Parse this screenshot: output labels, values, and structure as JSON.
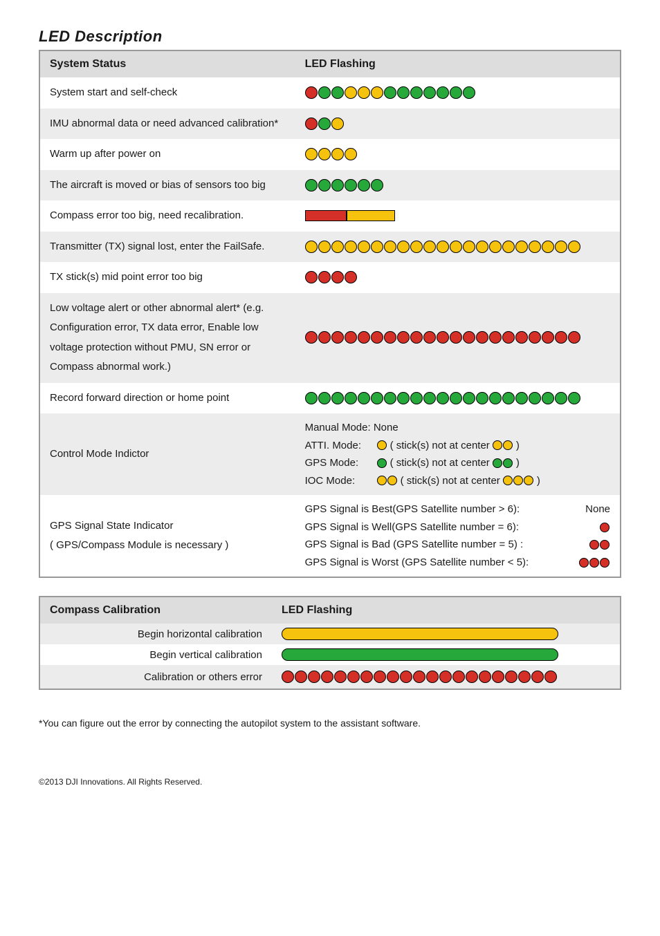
{
  "title": "LED Description",
  "colors": {
    "red": "#d43027",
    "green": "#26a83b",
    "yellow": "#f5c20e"
  },
  "table1": {
    "headers": {
      "col1": "System Status",
      "col2": "LED Flashing"
    },
    "rows": [
      {
        "label": "System start and self-check",
        "leds": [
          "red",
          "green",
          "green",
          "yellow",
          "yellow",
          "yellow",
          "green",
          "green",
          "green",
          "green",
          "green",
          "green",
          "green"
        ]
      },
      {
        "label": "IMU abnormal data or need advanced calibration*",
        "leds": [
          "red",
          "green",
          "yellow"
        ]
      },
      {
        "label": "Warm up after power on",
        "leds": [
          "yellow",
          "yellow",
          "yellow",
          "yellow"
        ]
      },
      {
        "label": "The aircraft is moved or bias of sensors too big",
        "leds": [
          "green",
          "green",
          "green",
          "green",
          "green",
          "green"
        ]
      },
      {
        "label": "Compass error too big, need recalibration.",
        "bars": [
          "red",
          "yellow"
        ]
      },
      {
        "label": "Transmitter (TX) signal lost, enter the FailSafe.",
        "leds": [
          "yellow",
          "yellow",
          "yellow",
          "yellow",
          "yellow",
          "yellow",
          "yellow",
          "yellow",
          "yellow",
          "yellow",
          "yellow",
          "yellow",
          "yellow",
          "yellow",
          "yellow",
          "yellow",
          "yellow",
          "yellow",
          "yellow",
          "yellow",
          "yellow"
        ]
      },
      {
        "label": "TX stick(s) mid point error too big",
        "leds": [
          "red",
          "red",
          "red",
          "red"
        ]
      },
      {
        "label": "Low voltage alert or other abnormal alert* (e.g. Configuration error, TX data error, Enable low voltage protection without PMU, SN error or Compass abnormal work.)",
        "leds": [
          "red",
          "red",
          "red",
          "red",
          "red",
          "red",
          "red",
          "red",
          "red",
          "red",
          "red",
          "red",
          "red",
          "red",
          "red",
          "red",
          "red",
          "red",
          "red",
          "red",
          "red"
        ]
      },
      {
        "label": "Record forward direction or home point",
        "leds": [
          "green",
          "green",
          "green",
          "green",
          "green",
          "green",
          "green",
          "green",
          "green",
          "green",
          "green",
          "green",
          "green",
          "green",
          "green",
          "green",
          "green",
          "green",
          "green",
          "green",
          "green"
        ]
      }
    ],
    "control_mode": {
      "label": "Control Mode Indictor",
      "lines": {
        "manual": "Manual Mode: None",
        "atti_label": "ATTI. Mode:",
        "gps_label": "GPS Mode:",
        "ioc_label": "IOC Mode:",
        "not_center": "( stick(s) not at center",
        "close_paren": ")"
      },
      "atti": {
        "base": [
          "yellow"
        ],
        "nc": [
          "yellow",
          "yellow"
        ]
      },
      "gps": {
        "base": [
          "green"
        ],
        "nc": [
          "green",
          "green"
        ]
      },
      "ioc": {
        "base": [
          "yellow",
          "yellow"
        ],
        "nc": [
          "yellow",
          "yellow",
          "yellow"
        ]
      }
    },
    "gps_signal": {
      "label": "GPS Signal State Indicator",
      "sublabel": "( GPS/Compass Module is necessary )",
      "lines": [
        {
          "text": "GPS Signal is Best(GPS Satellite number > 6):",
          "none": "None",
          "leds": []
        },
        {
          "text": "GPS Signal is Well(GPS Satellite number = 6):",
          "leds": [
            "red"
          ]
        },
        {
          "text": "GPS Signal is Bad (GPS Satellite number = 5) :",
          "leds": [
            "red",
            "red"
          ]
        },
        {
          "text": "GPS Signal is Worst (GPS Satellite number < 5):",
          "leds": [
            "red",
            "red",
            "red"
          ]
        }
      ]
    }
  },
  "table2": {
    "headers": {
      "col1": "Compass Calibration",
      "col2": "LED Flashing"
    },
    "rows": [
      {
        "label": "Begin horizontal calibration",
        "pill": "yellow"
      },
      {
        "label": "Begin vertical calibration",
        "pill": "green"
      },
      {
        "label": "Calibration or others error",
        "leds": [
          "red",
          "red",
          "red",
          "red",
          "red",
          "red",
          "red",
          "red",
          "red",
          "red",
          "red",
          "red",
          "red",
          "red",
          "red",
          "red",
          "red",
          "red",
          "red",
          "red",
          "red"
        ]
      }
    ]
  },
  "footnote": "*You can figure out the error by connecting the autopilot system to the assistant software.",
  "copyright": "©2013 DJI Innovations. All Rights Reserved."
}
